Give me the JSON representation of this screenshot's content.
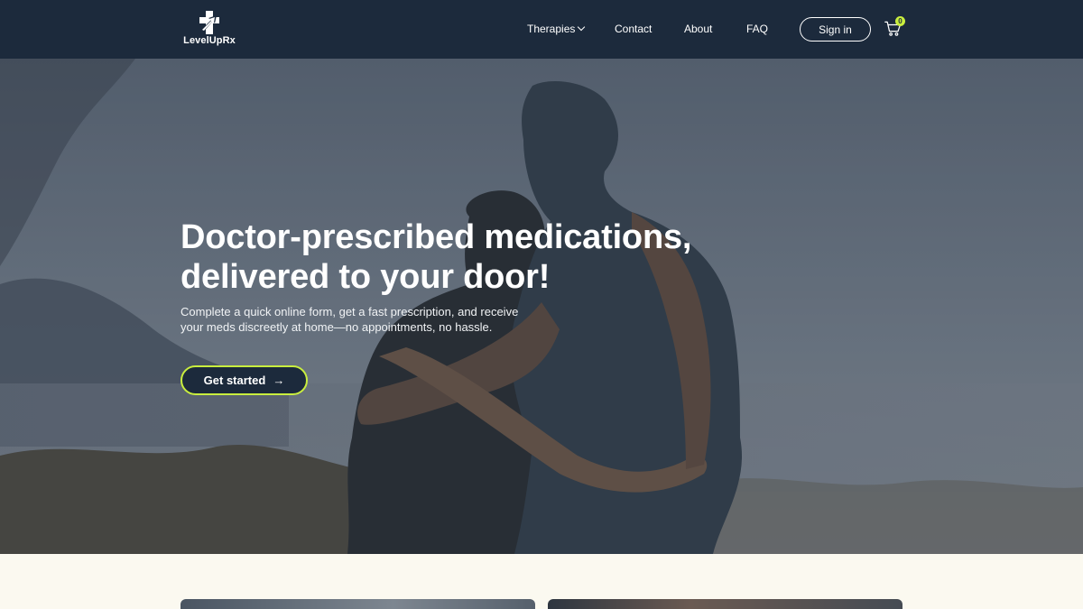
{
  "brand": {
    "name": "LevelUpRx",
    "accent": "#c9ee3e",
    "navy": "#1c2a3c"
  },
  "nav": {
    "therapies": "Therapies",
    "contact": "Contact",
    "about": "About",
    "faq": "FAQ",
    "signin": "Sign in",
    "cart_count": "0"
  },
  "icons": {
    "logo": "cross-arrow-logo-icon",
    "cart": "shopping-cart-icon",
    "chevron": "chevron-down-icon",
    "arrow": "arrow-right-icon"
  },
  "hero": {
    "title_line1": "Doctor-prescribed medications,",
    "title_line2": "delivered to your door!",
    "subtitle_line1": "Complete a quick online form, get a fast prescription, and receive",
    "subtitle_line2": "your meds discreetly at home—no appointments, no hassle.",
    "cta": "Get started"
  }
}
